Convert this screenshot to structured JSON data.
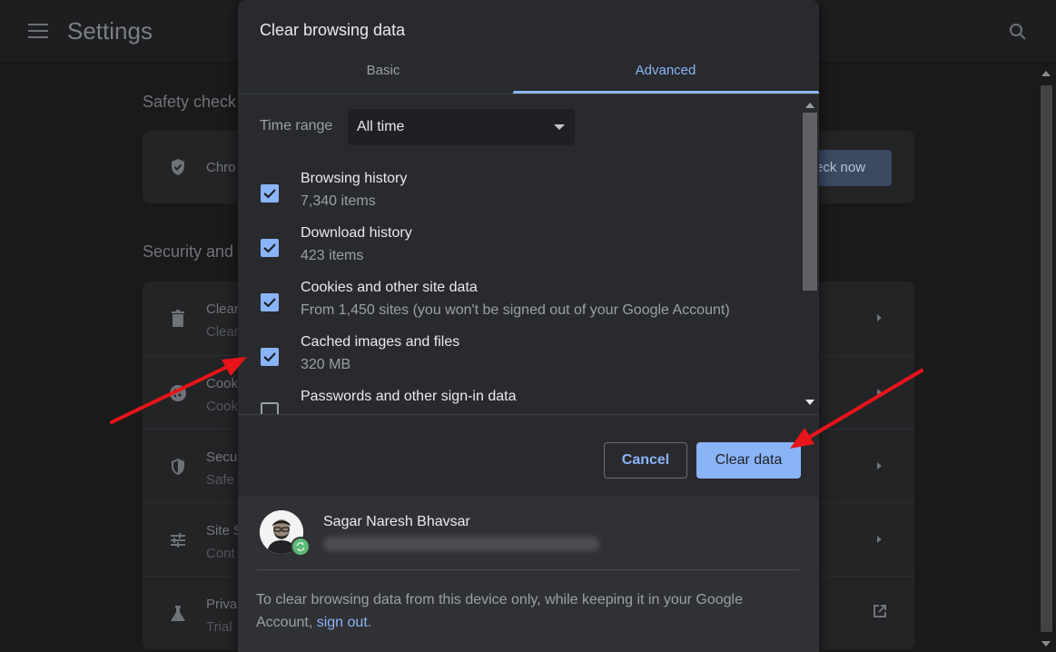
{
  "app": {
    "title": "Settings"
  },
  "background": {
    "safety_check_title": "Safety check",
    "safety_row_text": "Chro",
    "check_now_label": "eck now",
    "security_title": "Security and",
    "rows": [
      {
        "title": "Clear",
        "sub": "Clear",
        "icon": "trash-icon",
        "trailing": "chevron-right-icon"
      },
      {
        "title": "Cook",
        "sub": "Cook",
        "icon": "cookie-icon",
        "trailing": "chevron-right-icon"
      },
      {
        "title": "Secu",
        "sub": "Safe",
        "icon": "shield-icon",
        "trailing": "chevron-right-icon"
      },
      {
        "title": "Site S",
        "sub": "Cont",
        "icon": "sliders-icon",
        "trailing": "chevron-right-icon"
      },
      {
        "title": "Priva",
        "sub": "Trial",
        "icon": "flask-icon",
        "trailing": "external-link-icon"
      }
    ]
  },
  "dialog": {
    "title": "Clear browsing data",
    "tabs": [
      {
        "label": "Basic",
        "active": false
      },
      {
        "label": "Advanced",
        "active": true
      }
    ],
    "time_range": {
      "label": "Time range",
      "value": "All time"
    },
    "items": [
      {
        "title": "Browsing history",
        "sub": "7,340 items",
        "checked": true
      },
      {
        "title": "Download history",
        "sub": "423 items",
        "checked": true
      },
      {
        "title": "Cookies and other site data",
        "sub": "From 1,450 sites (you won't be signed out of your Google Account)",
        "checked": true
      },
      {
        "title": "Cached images and files",
        "sub": "320 MB",
        "checked": true
      },
      {
        "title": "Passwords and other sign-in data",
        "sub": "",
        "checked": false
      }
    ],
    "buttons": {
      "cancel": "Cancel",
      "clear": "Clear data"
    },
    "account": {
      "name": "Sagar Naresh Bhavsar"
    },
    "footer_note": "To clear browsing data from this device only, while keeping it in your Google Account,",
    "sign_out": "sign out",
    "footer_end": "."
  },
  "colors": {
    "accent": "#8ab4f8",
    "dialog_bg": "#292a2d",
    "annotation": "#e8141a"
  }
}
